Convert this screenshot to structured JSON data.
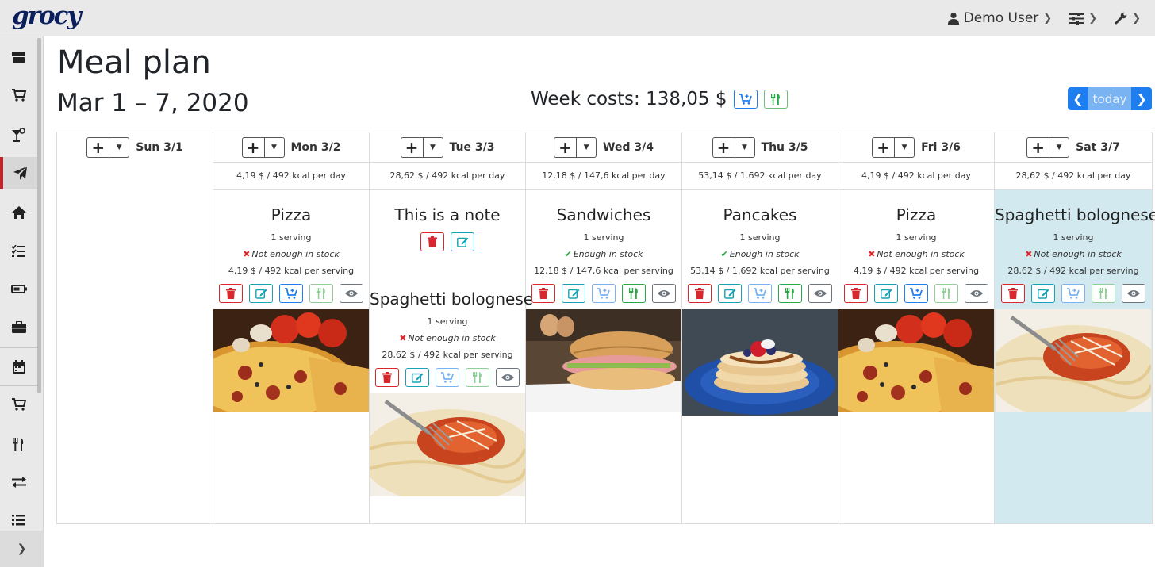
{
  "app": {
    "logo": "grocy"
  },
  "topnav": {
    "user": "Demo User"
  },
  "header": {
    "title": "Meal plan",
    "range": "Mar 1 – 7, 2020",
    "week_costs": "Week costs: 138,05 $",
    "today_label": "today"
  },
  "days": [
    {
      "label": "Sun 3/1",
      "summary": ""
    },
    {
      "label": "Mon 3/2",
      "summary": "4,19 $ / 492 kcal per day"
    },
    {
      "label": "Tue 3/3",
      "summary": "28,62 $ / 492 kcal per day"
    },
    {
      "label": "Wed 3/4",
      "summary": "12,18 $ / 147,6 kcal per day"
    },
    {
      "label": "Thu 3/5",
      "summary": "53,14 $ / 1.692 kcal per day"
    },
    {
      "label": "Fri 3/6",
      "summary": "4,19 $ / 492 kcal per day"
    },
    {
      "label": "Sat 3/7",
      "summary": "28,62 $ / 492 kcal per day"
    }
  ],
  "entries": {
    "mon": {
      "title": "Pizza",
      "servings": "1 serving",
      "stock": "Not enough in stock",
      "price": "4,19 $ / 492 kcal per serving"
    },
    "tue_note": {
      "title": "This is a note"
    },
    "tue": {
      "title": "Spaghetti bolognese",
      "servings": "1 serving",
      "stock": "Not enough in stock",
      "price": "28,62 $ / 492 kcal per serving"
    },
    "wed": {
      "title": "Sandwiches",
      "servings": "1 serving",
      "stock": "Enough in stock",
      "price": "12,18 $ / 147,6 kcal per serving"
    },
    "thu": {
      "title": "Pancakes",
      "servings": "1 serving",
      "stock": "Enough in stock",
      "price": "53,14 $ / 1.692 kcal per serving"
    },
    "fri": {
      "title": "Pizza",
      "servings": "1 serving",
      "stock": "Not enough in stock",
      "price": "4,19 $ / 492 kcal per serving"
    },
    "sat": {
      "title": "Spaghetti bolognese",
      "servings": "1 serving",
      "stock": "Not enough in stock",
      "price": "28,62 $ / 492 kcal per serving"
    }
  },
  "colors": {
    "primary": "#1e7ef0",
    "danger": "#d9272e",
    "success": "#28a745",
    "info": "#17a2b8",
    "today_bg": "#d2e9f0"
  }
}
